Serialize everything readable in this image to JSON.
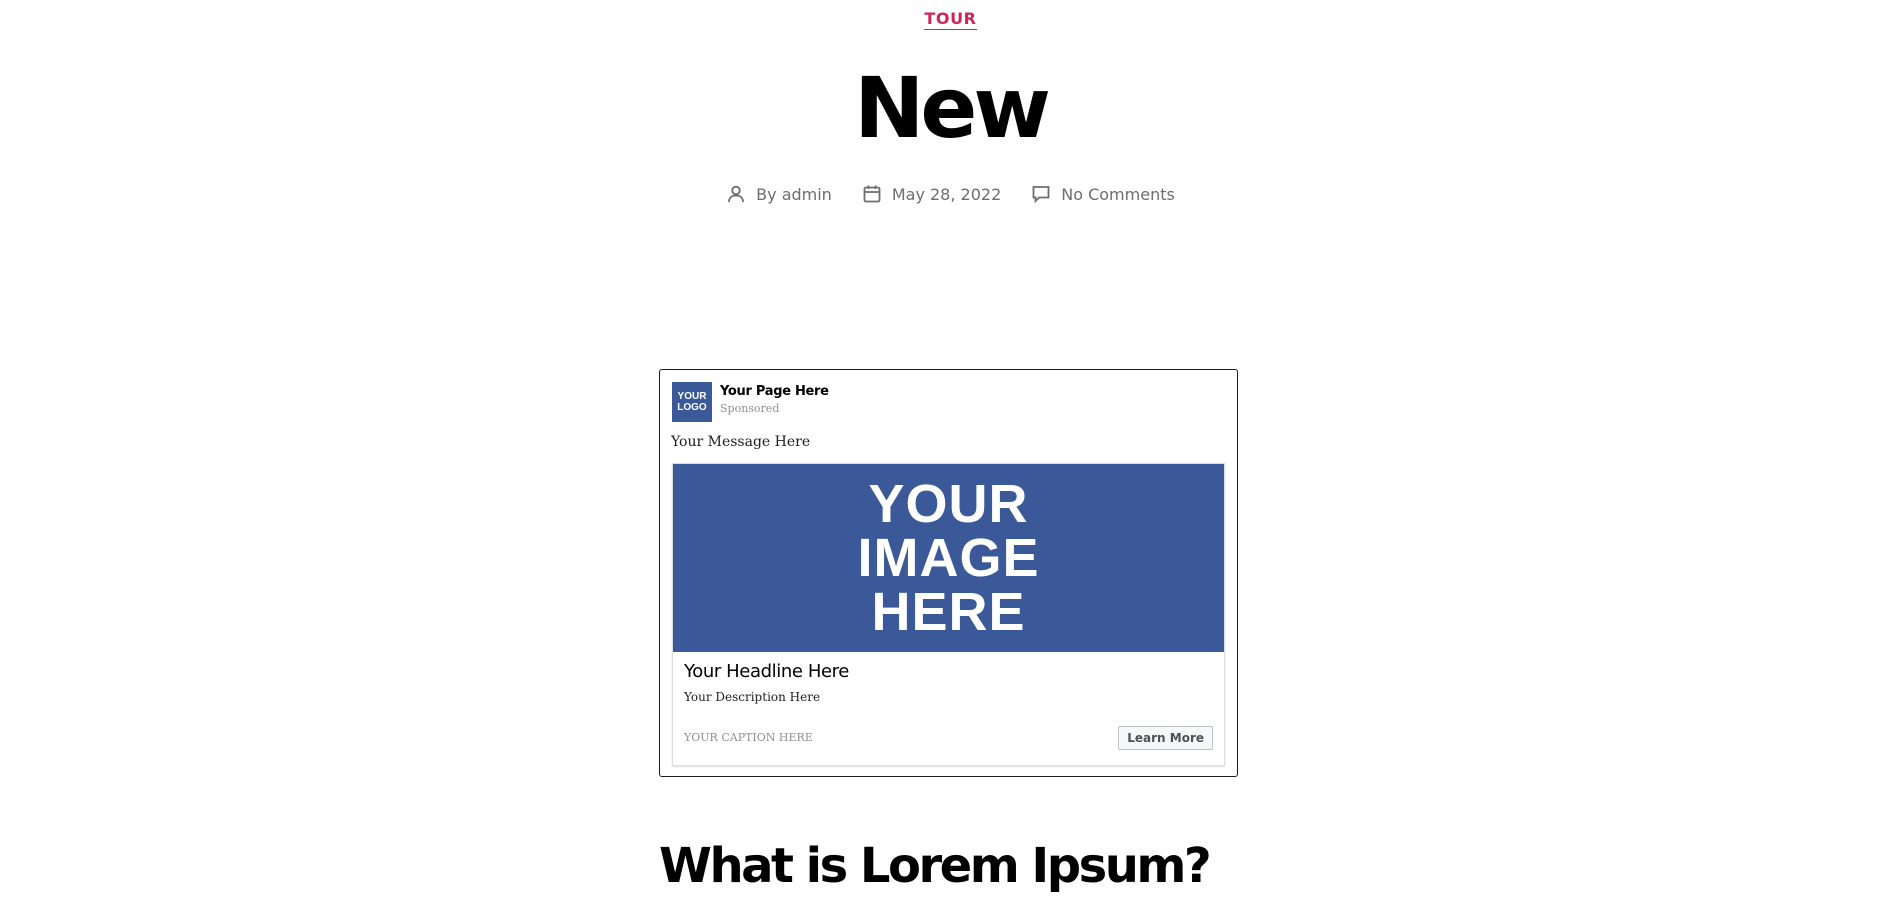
{
  "post": {
    "category": "TOUR",
    "title": "New",
    "meta": {
      "author": "By admin",
      "date": "May 28, 2022",
      "comments": "No Comments"
    },
    "icons": {
      "author": "user-icon",
      "date": "calendar-icon",
      "comments": "comment-icon"
    },
    "accent_color": "#cd2653"
  },
  "ad": {
    "logo_text": "YOUR\nLOGO",
    "page_name": "Your Page Here",
    "sponsored": "Sponsored",
    "message": "Your Message Here",
    "image_text": "YOUR\nIMAGE\nHERE",
    "headline": "Your Headline Here",
    "description": "Your Description Here",
    "caption": "YOUR CAPTION HERE",
    "cta_label": "Learn More",
    "brand_color": "#3b5998"
  },
  "content": {
    "heading": "What is Lorem Ipsum?"
  }
}
